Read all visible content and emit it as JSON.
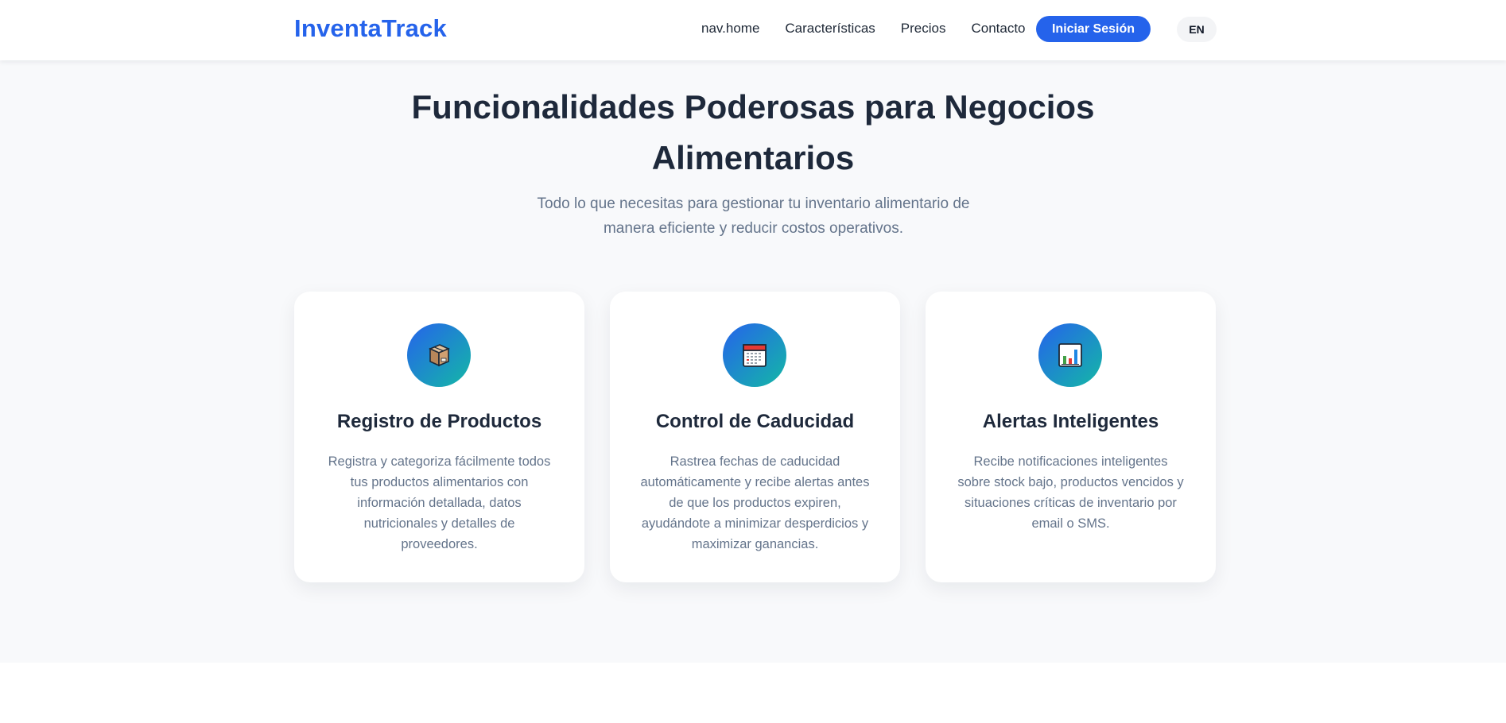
{
  "header": {
    "brand": "InventaTrack",
    "nav": [
      {
        "label": "nav.home"
      },
      {
        "label": "Características"
      },
      {
        "label": "Precios"
      },
      {
        "label": "Contacto"
      }
    ],
    "login_label": "Iniciar Sesión",
    "lang_label": "EN"
  },
  "features": {
    "title": "Funcionalidades Poderosas para Negocios Alimentarios",
    "subtitle": "Todo lo que necesitas para gestionar tu inventario alimentario de manera eficiente y reducir costos operativos.",
    "cards": [
      {
        "icon": "package-icon",
        "title": "Registro de Productos",
        "description": "Registra y categoriza fácilmente todos tus productos alimentarios con información detallada, datos nutricionales y detalles de proveedores."
      },
      {
        "icon": "calendar-icon",
        "title": "Control de Caducidad",
        "description": "Rastrea fechas de caducidad automáticamente y recibe alertas antes de que los productos expiren, ayudándote a minimizar desperdicios y maximizar ganancias."
      },
      {
        "icon": "bar-chart-icon",
        "title": "Alertas Inteligentes",
        "description": "Recibe notificaciones inteligentes sobre stock bajo, productos vencidos y situaciones críticas de inventario por email o SMS."
      }
    ]
  },
  "colors": {
    "accent": "#2563eb",
    "gradient_end": "#14b8a6",
    "heading": "#1e293b",
    "muted_text": "#64748b",
    "section_background": "#f8f9fb"
  }
}
